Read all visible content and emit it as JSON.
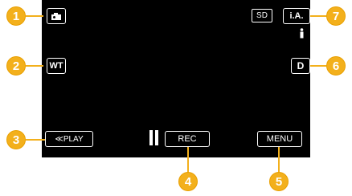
{
  "buttons": {
    "mode": {
      "icon": "camcorder-icon"
    },
    "sd": "SD",
    "ia": "i.A.",
    "wt": "WT",
    "display": "D",
    "play": "≪PLAY",
    "rec": "REC",
    "menu": "MENU"
  },
  "callouts": [
    "1",
    "2",
    "3",
    "4",
    "5",
    "6",
    "7"
  ],
  "colors": {
    "screen": "#000000",
    "callout": "#f3b01c",
    "text": "#ffffff"
  }
}
